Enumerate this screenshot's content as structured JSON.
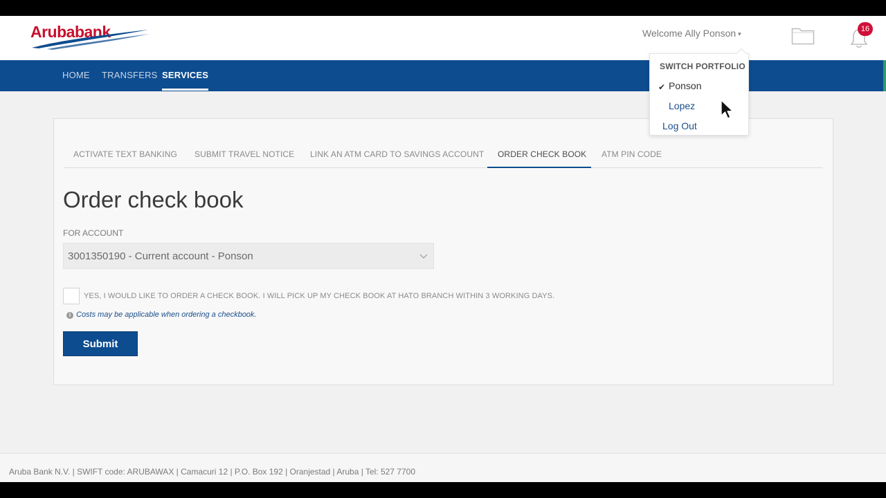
{
  "brand": {
    "logo_text": "Arubabank",
    "primary_color": "#0d4c8f",
    "accent_color": "#c8102e"
  },
  "header": {
    "welcome": "Welcome Ally Ponson",
    "notification_count": "16"
  },
  "nav": {
    "items": [
      {
        "label": "HOME",
        "active": false
      },
      {
        "label": "TRANSFERS",
        "active": false
      },
      {
        "label": "SERVICES",
        "active": true
      }
    ]
  },
  "user_menu": {
    "header": "SWITCH PORTFOLIO",
    "items": [
      {
        "label": "Ponson",
        "checked": true
      },
      {
        "label": "Lopez",
        "checked": false
      },
      {
        "label": "Log Out",
        "checked": false
      }
    ]
  },
  "service_tabs": [
    {
      "label": "ACTIVATE TEXT BANKING",
      "active": false
    },
    {
      "label": "SUBMIT TRAVEL NOTICE",
      "active": false
    },
    {
      "label": "LINK AN ATM CARD TO SAVINGS ACCOUNT",
      "active": false
    },
    {
      "label": "ORDER CHECK BOOK",
      "active": true
    },
    {
      "label": "ATM PIN CODE",
      "active": false
    }
  ],
  "form": {
    "title": "Order check book",
    "account_label": "FOR ACCOUNT",
    "account_value": "3001350190 - Current account - Ponson",
    "confirm_label": "YES, I WOULD LIKE TO ORDER A CHECK BOOK. I WILL PICK UP MY CHECK BOOK AT HATO BRANCH WITHIN 3 WORKING DAYS.",
    "confirm_checked": false,
    "info_note": "Costs may be applicable when ordering a checkbook.",
    "submit_label": "Submit"
  },
  "footer": {
    "text": "Aruba Bank N.V. | SWIFT code: ARUBAWAX | Camacuri 12 | P.O. Box 192 | Oranjestad | Aruba | Tel: 527 7700"
  },
  "icons": {
    "folder": "folder-icon",
    "notifications": "bell-icon",
    "info": "info-icon",
    "dropdown": "chevron-down-icon",
    "check": "checkmark-icon",
    "pointer": "cursor-icon"
  }
}
